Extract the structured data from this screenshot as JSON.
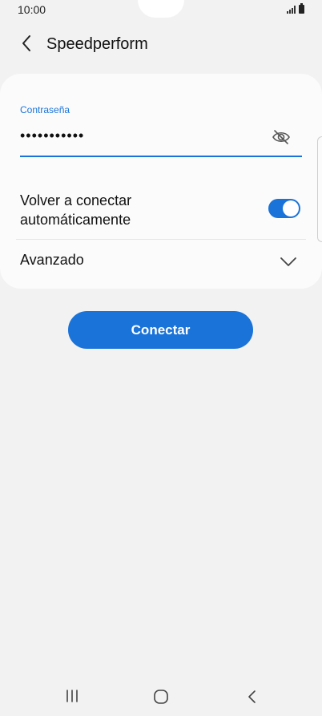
{
  "status_bar": {
    "time": "10:00"
  },
  "header": {
    "title": "Speedperform",
    "back_icon": "back-arrow-icon"
  },
  "password": {
    "label": "Contraseña",
    "value": "•••••••••••",
    "visibility_icon": "eye-off-icon"
  },
  "reconnect": {
    "label": "Volver a conectar automáticamente",
    "enabled": true
  },
  "advanced": {
    "label": "Avanzado",
    "icon": "chevron-down-icon"
  },
  "connect_button": {
    "label": "Conectar"
  },
  "colors": {
    "accent": "#1a73d9",
    "background": "#f2f2f2",
    "card": "#fbfbfb"
  }
}
